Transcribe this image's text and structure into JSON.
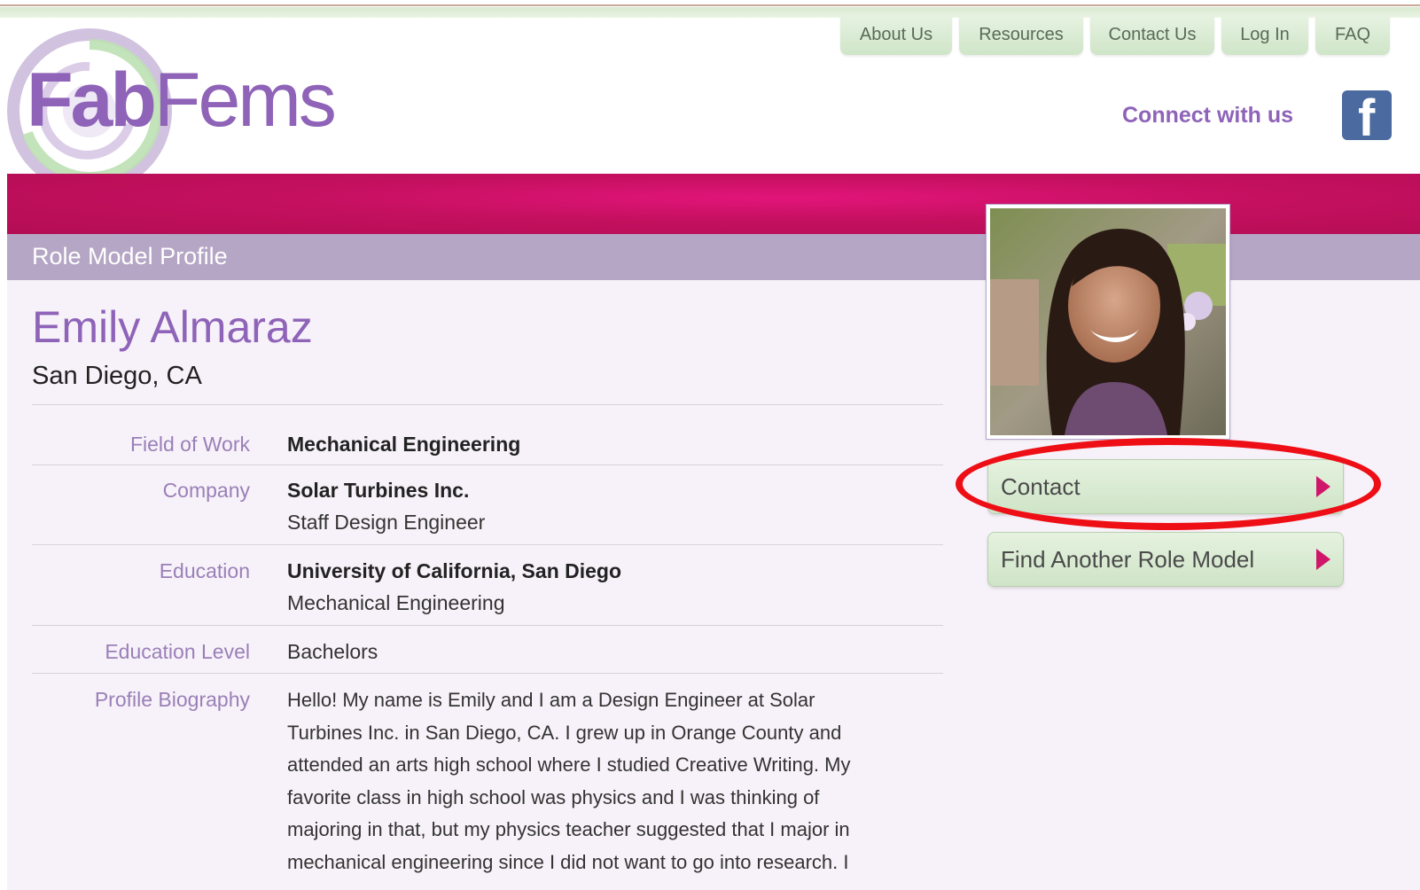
{
  "logo": {
    "part1": "Fab",
    "part2": "Fems"
  },
  "nav": {
    "items": [
      "About Us",
      "Resources",
      "Contact Us",
      "Log In",
      "FAQ"
    ]
  },
  "social": {
    "connect_label": "Connect with us",
    "icon": "facebook-icon"
  },
  "section_title": "Role Model Profile",
  "profile": {
    "name": "Emily Almaraz",
    "location": "San Diego, CA",
    "field_of_work": {
      "label": "Field of Work",
      "value": "Mechanical Engineering"
    },
    "company": {
      "label": "Company",
      "value": "Solar Turbines Inc.",
      "sub": "Staff Design Engineer"
    },
    "education": {
      "label": "Education",
      "value": "University of California, San Diego",
      "sub": "Mechanical Engineering"
    },
    "education_level": {
      "label": "Education Level",
      "value": "Bachelors"
    },
    "biography": {
      "label": "Profile Biography",
      "lines": [
        "Hello! My name is Emily and I am a Design Engineer at Solar",
        "Turbines Inc. in San Diego, CA. I grew up in Orange County and",
        "attended an arts high school where I studied Creative Writing. My",
        "favorite class in high school was physics and I was thinking of",
        "majoring in that, but my physics teacher suggested that I major in",
        "mechanical engineering since I did not want to go into research. I"
      ]
    }
  },
  "actions": {
    "contact": "Contact",
    "find_another": "Find Another Role Model"
  },
  "colors": {
    "brand_purple": "#8e63b8",
    "banner_pink": "#c4105f",
    "button_green": "#d8ebd1",
    "highlight_red": "#ee0f16"
  }
}
